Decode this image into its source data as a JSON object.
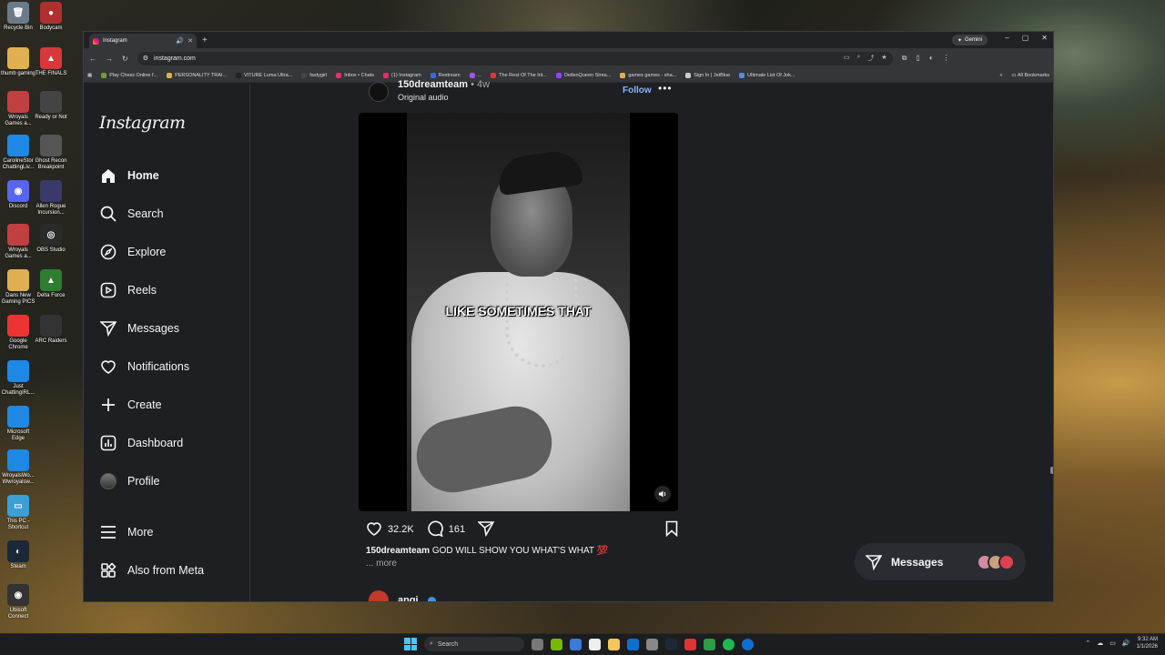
{
  "desktop": {
    "icons": [
      {
        "label": "Recycle Bin",
        "glyph": "🗑",
        "color": "#6b7b8a"
      },
      {
        "label": "Bodycam",
        "glyph": "●",
        "color": "#b03030"
      },
      {
        "label": "thumb gaming",
        "glyph": "",
        "color": "#e0b050"
      },
      {
        "label": "THE FINALS",
        "glyph": "▲",
        "color": "#d8383a"
      },
      {
        "label": "Wroyals Games a...",
        "glyph": "",
        "color": "#c04040"
      },
      {
        "label": "Ready or Not",
        "glyph": "",
        "color": "#444"
      },
      {
        "label": "CarolineStor ChattingLiv...",
        "glyph": "",
        "color": "#1e88e5"
      },
      {
        "label": "Ghost Recon Breakpoint",
        "glyph": "",
        "color": "#555"
      },
      {
        "label": "Discord",
        "glyph": "◉",
        "color": "#5865f2"
      },
      {
        "label": "Allen Rogue Incursion...",
        "glyph": "",
        "color": "#3a3a6a"
      },
      {
        "label": "Wroyals Games a...",
        "glyph": "",
        "color": "#c04040"
      },
      {
        "label": "OBS Studio",
        "glyph": "◎",
        "color": "#2b2b2b"
      },
      {
        "label": "Dans New Gaming PICS",
        "glyph": "",
        "color": "#e0b050"
      },
      {
        "label": "Delta Force",
        "glyph": "▲",
        "color": "#2e7d32"
      },
      {
        "label": "Google Chrome",
        "glyph": "",
        "color": "#e33"
      },
      {
        "label": "ARC Raiders",
        "glyph": "",
        "color": "#333"
      },
      {
        "label": "Just ChattingIRL...",
        "glyph": "",
        "color": "#1e88e5"
      },
      {
        "label": "Microsoft Edge",
        "glyph": "",
        "color": "#1e88e5"
      },
      {
        "label": "WroyalsWo... Wwroyalsw...",
        "glyph": "",
        "color": "#1e88e5"
      },
      {
        "label": "This PC - Shortcut",
        "glyph": "▭",
        "color": "#3aa0d8"
      },
      {
        "label": "Steam",
        "glyph": "◐",
        "color": "#1b2838"
      },
      {
        "label": "Ubisoft Connect",
        "glyph": "◉",
        "color": "#333"
      }
    ]
  },
  "browser": {
    "tab_title": "Instagram",
    "tab_mute": "🔊",
    "tab_close": "✕",
    "new_tab": "+",
    "gemini_label": "Gemini",
    "win_min": "–",
    "win_max": "▢",
    "win_close": "✕",
    "url": "instagram.com",
    "nav_back": "←",
    "nav_forward": "→",
    "nav_reload": "↻",
    "bookmarks": [
      {
        "label": "Play Chess Online f...",
        "color": "#7a9a3a"
      },
      {
        "label": "PERSONALITY TRAI...",
        "color": "#e0b050"
      },
      {
        "label": "VITURE Luma Ultra...",
        "color": "#222"
      },
      {
        "label": "fastygirl",
        "color": "#444"
      },
      {
        "label": "Inbox • Chats",
        "color": "#e1306c"
      },
      {
        "label": "(1) Instagram",
        "color": "#e1306c"
      },
      {
        "label": "Restream",
        "color": "#3a6ae0"
      },
      {
        "label": "...",
        "color": "#a055e0"
      },
      {
        "label": "The Rest Of The Int...",
        "color": "#e53935"
      },
      {
        "label": "DeilenQueen Strea...",
        "color": "#9146ff"
      },
      {
        "label": "games games - sha...",
        "color": "#e0b050"
      },
      {
        "label": "Sign In | JetBlue",
        "color": "#ccc"
      },
      {
        "label": "Ultimate List Of Jok...",
        "color": "#5b8ad8"
      }
    ],
    "bookmarks_more": "»",
    "all_bookmarks": "All Bookmarks"
  },
  "instagram": {
    "logo": "Instagram",
    "nav": [
      {
        "label": "Home",
        "icon": "home-icon",
        "glyph": "⌂",
        "active": true
      },
      {
        "label": "Search",
        "icon": "search-icon",
        "glyph": "⌕",
        "active": false
      },
      {
        "label": "Explore",
        "icon": "compass-icon",
        "glyph": "◎",
        "active": false
      },
      {
        "label": "Reels",
        "icon": "reels-icon",
        "glyph": "▷",
        "active": false
      },
      {
        "label": "Messages",
        "icon": "messages-icon",
        "glyph": "➢",
        "active": false
      },
      {
        "label": "Notifications",
        "icon": "heart-icon",
        "glyph": "♡",
        "active": false
      },
      {
        "label": "Create",
        "icon": "plus-icon",
        "glyph": "+",
        "active": false
      },
      {
        "label": "Dashboard",
        "icon": "dashboard-icon",
        "glyph": "▥",
        "active": false
      },
      {
        "label": "Profile",
        "icon": "profile-icon",
        "glyph": "",
        "active": false
      }
    ],
    "more_label": "More",
    "meta_label": "Also from Meta",
    "post": {
      "username": "150dreamteam",
      "age": "• 4w",
      "audio": "Original audio",
      "follow": "Follow",
      "more": "•••",
      "video_caption": "LIKE SOMETIMES THAT",
      "likes": "32.2K",
      "comments": "161",
      "caption_user": "150dreamteam",
      "caption_text": "GOD WILL SHOW YOU WHAT'S WHAT 💯",
      "caption_more": "... more"
    },
    "next_post_user": "angi",
    "messages_pill": "Messages"
  },
  "taskbar": {
    "search_placeholder": "Search",
    "time": "9:32 AM",
    "date": "1/1/2026"
  },
  "colors": {
    "accent": "#8ab4f8",
    "ig_bg": "#1e1f22"
  }
}
